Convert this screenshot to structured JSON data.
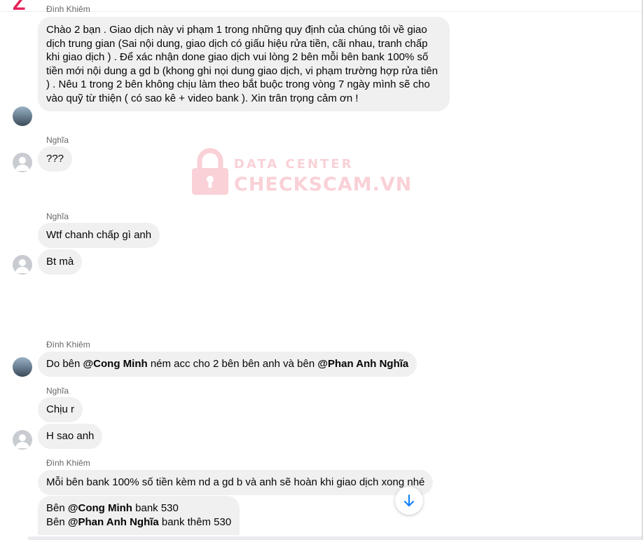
{
  "header": {
    "cut_sender": "Đình Khiêm"
  },
  "messages": {
    "m1": {
      "text": "Chào 2 bạn . Giao dịch này vi phạm 1 trong những quy định của chúng tôi về giao dịch trung gian (Sai nội dung, giao dịch có giấu hiệu rửa tiền, cãi nhau, tranh chấp khi giao dịch ) . Để xác nhận done giao dịch vui lòng 2 bên mỗi bên bank 100% số tiền mới nội dung a gd b (khong ghi nọi dung giao dịch, vi phạm trường hợp rửa tiên ) . Nêu 1 trong 2 bên không chịu làm theo bắt buộc trong vòng 7 ngày mình sẽ cho vào quỹ từ thiện ( có sao kê + video bank ). Xin trân trọng cảm ơn !"
    },
    "g2": {
      "sender": "Nghĩa"
    },
    "m2": {
      "text": "???"
    },
    "g3": {
      "sender": "Nghĩa"
    },
    "m3": {
      "text": "Wtf chanh chấp gì anh"
    },
    "m4": {
      "text": "Bt mà"
    },
    "g4": {
      "sender": "Đình Khiêm"
    },
    "m5": {
      "pre": "Do bên ",
      "mention1": "@Cong Minh",
      "mid": " ném acc cho 2 bên bên anh và bên ",
      "mention2": "@Phan Anh Nghĩa"
    },
    "g5": {
      "sender": "Nghĩa"
    },
    "m6": {
      "text": "Chịu r"
    },
    "m7": {
      "text": "H sao anh"
    },
    "g6": {
      "sender": "Đình Khiêm"
    },
    "m8": {
      "text": "Mỗi bên bank 100% số tiền kèm nd a gd b và anh sẽ hoàn khi giao dịch xong nhé"
    },
    "m9": {
      "l1_pre": "Bên ",
      "l1_mention": "@Cong Minh",
      "l1_post": " bank 530",
      "l2_pre": "Bên ",
      "l2_mention": "@Phan Anh Nghĩa",
      "l2_post": " bank thêm 530"
    }
  },
  "watermark": {
    "line1": "DATA CENTER",
    "line2": "CHECKSCAM.VN"
  },
  "icons": {
    "scroll_down": "arrow-down-icon",
    "lock": "lock-icon"
  },
  "colors": {
    "bubble": "#f0f0f0",
    "watermark": "#f39aa8",
    "accent": "#0a7cff",
    "brand": "#e5245a"
  }
}
